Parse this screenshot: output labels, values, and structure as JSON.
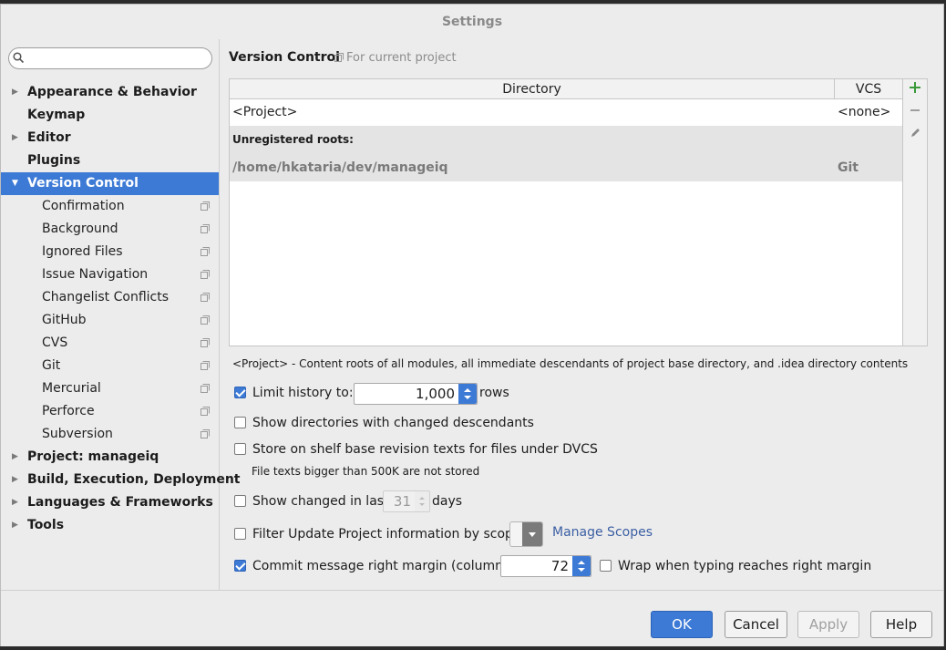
{
  "window": {
    "title": "Settings"
  },
  "search": {
    "placeholder": ""
  },
  "sidebar": {
    "items": [
      {
        "label": "Appearance & Behavior",
        "expandable": true
      },
      {
        "label": "Keymap",
        "expandable": false
      },
      {
        "label": "Editor",
        "expandable": true
      },
      {
        "label": "Plugins",
        "expandable": false
      },
      {
        "label": "Version Control",
        "expandable": true,
        "selected": true
      },
      {
        "label": "Confirmation"
      },
      {
        "label": "Background"
      },
      {
        "label": "Ignored Files"
      },
      {
        "label": "Issue Navigation"
      },
      {
        "label": "Changelist Conflicts"
      },
      {
        "label": "GitHub"
      },
      {
        "label": "CVS"
      },
      {
        "label": "Git"
      },
      {
        "label": "Mercurial"
      },
      {
        "label": "Perforce"
      },
      {
        "label": "Subversion"
      },
      {
        "label": "Project: manageiq",
        "expandable": true
      },
      {
        "label": "Build, Execution, Deployment",
        "expandable": true
      },
      {
        "label": "Languages & Frameworks",
        "expandable": true
      },
      {
        "label": "Tools",
        "expandable": true
      }
    ]
  },
  "page": {
    "title": "Version Control",
    "subtitle": "For current project"
  },
  "table": {
    "columns": [
      "Directory",
      "VCS"
    ],
    "rows": [
      {
        "directory": "<Project>",
        "vcs": "<none>"
      }
    ],
    "unregistered_header": "Unregistered roots:",
    "unregistered": [
      {
        "directory": "/home/hkataria/dev/manageiq",
        "vcs": "Git"
      }
    ]
  },
  "note": "<Project> - Content roots of all modules, all immediate descendants of project base directory, and .idea directory contents",
  "options": {
    "limit_history": {
      "checked": true,
      "label": "Limit history to:",
      "value": "1,000",
      "suffix": "rows"
    },
    "show_dirs": {
      "checked": false,
      "label": "Show directories with changed descendants"
    },
    "store_shelf": {
      "checked": false,
      "label": "Store on shelf base revision texts for files under DVCS",
      "hint": "File texts bigger than 500K are not stored"
    },
    "show_changed": {
      "checked": false,
      "label": "Show changed in last",
      "value": "31",
      "suffix": "days"
    },
    "filter_update": {
      "checked": false,
      "label": "Filter Update Project information by scope",
      "link": "Manage Scopes"
    },
    "commit_margin": {
      "checked": true,
      "label": "Commit message right margin (columns):",
      "value": "72"
    },
    "wrap_typing": {
      "checked": false,
      "label": "Wrap when typing reaches right margin"
    }
  },
  "footer": {
    "ok": "OK",
    "cancel": "Cancel",
    "apply": "Apply",
    "help": "Help"
  },
  "colors": {
    "accent": "#3d7ad6",
    "add": "#3a9a3a"
  }
}
